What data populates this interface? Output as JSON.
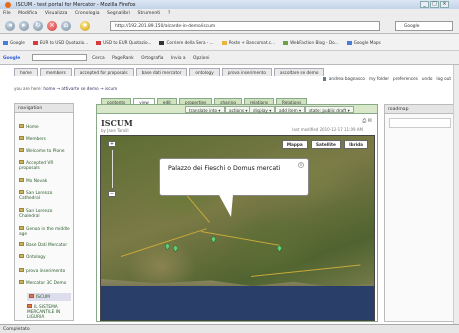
{
  "window": {
    "title": "ISCUM - test portal for Mercator - Mozilla Firefox"
  },
  "menubar": [
    "File",
    "Modifica",
    "Visualizza",
    "Cronologia",
    "Segnalibri",
    "Strumenti",
    "?"
  ],
  "navbar": {
    "url": "http://192.201.89.150/alcarde-in-demo/iscum",
    "search_placeholder": "Google"
  },
  "bookmarks": [
    {
      "label": "Google",
      "color": "#4a7bd8"
    },
    {
      "label": "EUR to USD Quotazio...",
      "color": "#d83b3b"
    },
    {
      "label": "USD to EUR Quotazio...",
      "color": "#d83b3b"
    },
    {
      "label": "Corriere della Sera - ...",
      "color": "#333333"
    },
    {
      "label": "Poste + Bancomat.c...",
      "color": "#e8b43a"
    },
    {
      "label": "WebFaction Blog - Do...",
      "color": "#6fa04a"
    },
    {
      "label": "Google Maps",
      "color": "#4a7bd8"
    }
  ],
  "googlebar": {
    "logo": "Google",
    "items": [
      "Cerca",
      "PageRank",
      "Ortografia",
      "Invia a",
      "Opzioni"
    ]
  },
  "portal": {
    "tabs": [
      "home",
      "members",
      "accepted for proposals",
      "base dati mercator",
      "ontology",
      "prova inserimento",
      "ascoltare se demo"
    ],
    "user_items": [
      "andrea bagnasco",
      "my folder",
      "preferences",
      "undo",
      "log out"
    ],
    "breadcrumb_prefix": "you are here:",
    "breadcrumb_path": "home → attivarte se demo → iscum"
  },
  "sidebar": {
    "title": "navigation",
    "items": [
      {
        "label": "Home",
        "level": 0
      },
      {
        "label": "Members",
        "level": 0
      },
      {
        "label": "Welcome to Plone",
        "level": 0
      },
      {
        "label": "Accepted VR proposals",
        "level": 0
      },
      {
        "label": "Mo Novak",
        "level": 0
      },
      {
        "label": "San Lorenzo Cathedral",
        "level": 0
      },
      {
        "label": "San Lorenzo Chaledral",
        "level": 0
      },
      {
        "label": "Genoa in the middle age",
        "level": 0
      },
      {
        "label": "Base Dati Mercator",
        "level": 0
      },
      {
        "label": "Ontology",
        "level": 0
      },
      {
        "label": "prova inserimento",
        "level": 0
      },
      {
        "label": "Mercator 3C Demo",
        "level": 0
      },
      {
        "label": "ISCUM",
        "level": 1,
        "selected": true
      },
      {
        "label": "IL SISTEMA MERCANTILE IN LIGURIA",
        "level": 1
      }
    ]
  },
  "action_tabs": [
    {
      "label": "contents",
      "active": false
    },
    {
      "label": "view",
      "active": true
    },
    {
      "label": "edit",
      "active": false
    },
    {
      "label": "properties",
      "active": false
    },
    {
      "label": "sharing",
      "active": false
    },
    {
      "label": "relations",
      "active": false
    },
    {
      "label": "Relations",
      "active": false
    }
  ],
  "toolbar": {
    "buttons": [
      "translate into ▾",
      "actions ▾",
      "display ▾",
      "add item ▾",
      "state: public draft ▾"
    ]
  },
  "page": {
    "title": "ISCUM",
    "byline": "by Jane Tarolli",
    "modified": "last modified 2010-12-17 11:09 AM"
  },
  "map": {
    "type_buttons": [
      "Mappa",
      "Satellite",
      "Ibrida"
    ],
    "zoom_in": "+",
    "zoom_out": "−",
    "infowindow_text": "Palazzo dei Fieschi o Domus mercati",
    "infowindow_close": "×",
    "marker_color": "#5fd07a",
    "sea_color": "#2a3e6a"
  },
  "rightpanel": {
    "title": "roadmap"
  },
  "status": {
    "text": "Completato"
  }
}
